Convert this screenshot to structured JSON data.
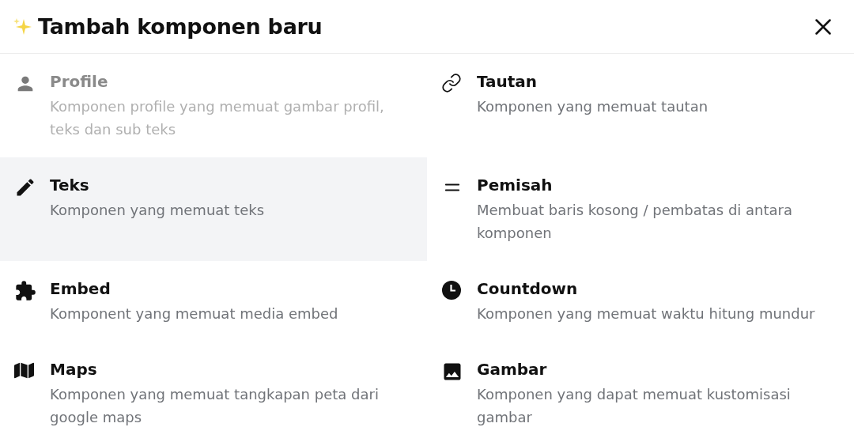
{
  "dialog": {
    "title": "Tambah komponen baru"
  },
  "components": [
    {
      "title": "Profile",
      "description": "Komponen profile yang memuat gambar profil, teks dan sub teks",
      "disabled": true,
      "selected": false
    },
    {
      "title": "Tautan",
      "description": "Komponen yang memuat tautan",
      "disabled": false,
      "selected": false
    },
    {
      "title": "Teks",
      "description": "Komponen yang memuat teks",
      "disabled": false,
      "selected": true
    },
    {
      "title": "Pemisah",
      "description": "Membuat baris kosong / pembatas di antara komponen",
      "disabled": false,
      "selected": false
    },
    {
      "title": "Embed",
      "description": "Komponent yang memuat media embed",
      "disabled": false,
      "selected": false
    },
    {
      "title": "Countdown",
      "description": "Komponen yang memuat waktu hitung mundur",
      "disabled": false,
      "selected": false
    },
    {
      "title": "Maps",
      "description": "Komponen yang memuat tangkapan peta dari google maps",
      "disabled": false,
      "selected": false
    },
    {
      "title": "Gambar",
      "description": "Komponen yang dapat memuat kustomisasi gambar",
      "disabled": false,
      "selected": false
    }
  ]
}
